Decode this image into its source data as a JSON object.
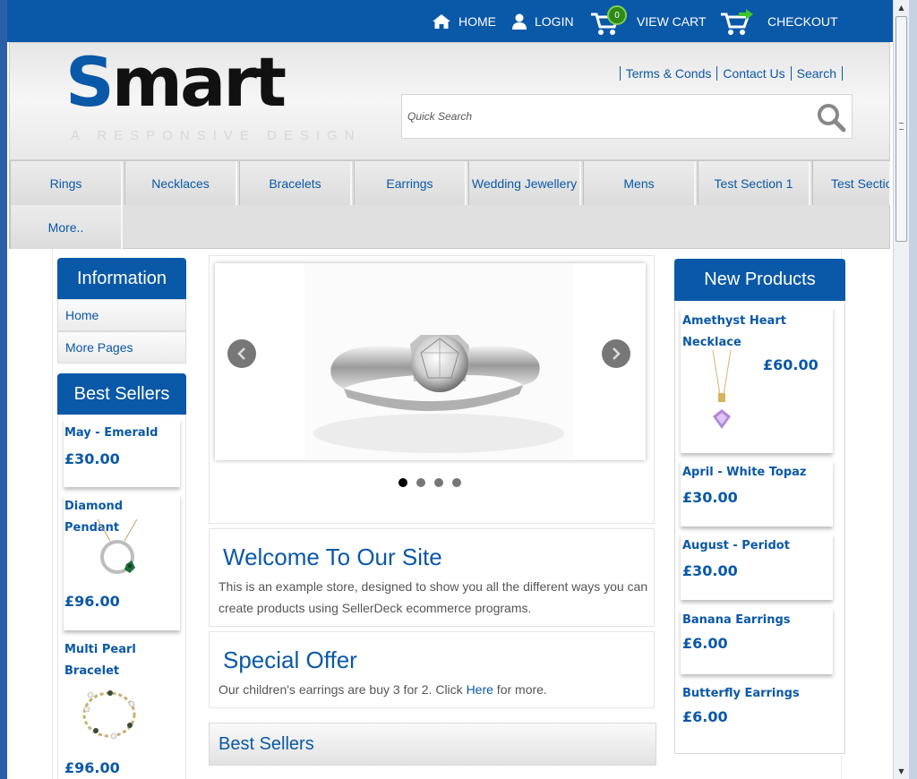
{
  "topbar": {
    "home": "HOME",
    "login": "LOGIN",
    "cart_count": "0",
    "view_cart": "VIEW CART",
    "checkout": "CHECKOUT"
  },
  "header": {
    "logo_part1": "S",
    "logo_part2": "mart",
    "tagline": "A RESPONSIVE DESIGN",
    "links": [
      "Terms & Conds",
      "Contact Us",
      "Search"
    ],
    "search_placeholder": "Quick Search"
  },
  "nav": {
    "items": [
      "Rings",
      "Necklaces",
      "Bracelets",
      "Earrings",
      "Wedding Jewellery",
      "Mens",
      "Test Section 1",
      "Test Section"
    ],
    "more": "More.."
  },
  "left": {
    "info_title": "Information",
    "info_links": [
      "Home",
      "More Pages"
    ],
    "best_title": "Best Sellers",
    "products": [
      {
        "name": "May - Emerald",
        "price": "£30.00"
      },
      {
        "name": "Diamond Pendant",
        "price": "£96.00"
      },
      {
        "name_line1": "Multi Pearl",
        "name_line2": "Bracelet",
        "price": "£96.00"
      }
    ]
  },
  "center": {
    "welcome_title": "Welcome To Our Site",
    "welcome_text": "This is an example store, designed to show you all the different ways you can create products using SellerDeck ecommerce programs.",
    "offer_title": "Special Offer",
    "offer_text_before": "Our children's earrings are buy 3 for 2. Click ",
    "offer_link": "Here",
    "offer_text_after": " for more.",
    "best_sellers": "Best Sellers"
  },
  "right": {
    "title": "New Products",
    "products": [
      {
        "name_line1": "Amethyst Heart",
        "name_line2": "Necklace",
        "price": "£60.00"
      },
      {
        "name": "April - White Topaz",
        "price": "£30.00"
      },
      {
        "name": "August - Peridot",
        "price": "£30.00"
      },
      {
        "name": "Banana Earrings",
        "price": "£6.00"
      },
      {
        "name": "Butterfly Earrings",
        "price": "£6.00"
      }
    ]
  },
  "colors": {
    "brand_blue": "#0a58a8",
    "cart_badge": "#2e8a17"
  },
  "icons": [
    "home-icon",
    "user-icon",
    "cart-icon",
    "checkout-cart-icon",
    "search-icon",
    "chevron-left-icon",
    "chevron-right-icon"
  ]
}
